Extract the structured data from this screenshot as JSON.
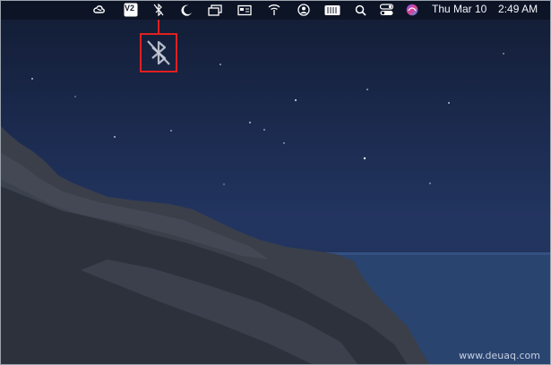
{
  "menubar": {
    "icons": [
      "creative-cloud-icon",
      "v2-app-icon",
      "bluetooth-off-icon",
      "moon-icon",
      "window-icon",
      "display-icon",
      "wifi-icon",
      "user-icon",
      "keyboard-icon",
      "search-icon",
      "control-center-icon",
      "siri-icon"
    ],
    "v2_label": "V2",
    "clock": {
      "date": "Thu Mar 10",
      "time": "2:49 AM"
    }
  },
  "callout": {
    "icon": "bluetooth-off-icon",
    "highlight_color": "#e02020"
  },
  "watermark": "www.deuaq.com",
  "colors": {
    "sky_top": "#121c33",
    "sky_bottom": "#223560",
    "sea": "#2a4470",
    "rock": "#2e3440"
  }
}
